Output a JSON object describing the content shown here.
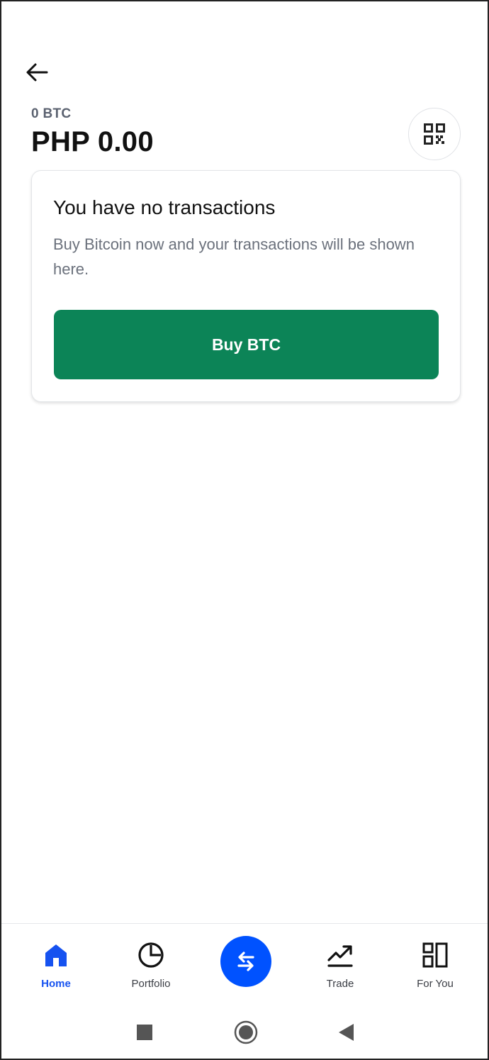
{
  "header": {
    "back_icon": "arrow-left-icon",
    "qr_icon": "qr-code-icon"
  },
  "balance": {
    "crypto": "0 BTC",
    "fiat": "PHP 0.00"
  },
  "empty_state": {
    "title": "You have no transactions",
    "description": "Buy Bitcoin now and your transactions will be shown here.",
    "button_label": "Buy BTC"
  },
  "bottom_nav": {
    "items": [
      {
        "label": "Home",
        "icon": "home-icon",
        "active": true
      },
      {
        "label": "Portfolio",
        "icon": "pie-chart-icon",
        "active": false
      },
      {
        "label": "",
        "icon": "swap-arrows-icon",
        "active": false
      },
      {
        "label": "Trade",
        "icon": "trend-up-icon",
        "active": false
      },
      {
        "label": "For You",
        "icon": "grid-icon",
        "active": false
      }
    ]
  },
  "system_nav": {
    "recents_icon": "square-icon",
    "home_icon": "circle-icon",
    "back_icon": "triangle-back-icon"
  },
  "colors": {
    "accent_blue": "#0052ff",
    "buy_green": "#0c8457",
    "active_nav": "#1652f0"
  }
}
